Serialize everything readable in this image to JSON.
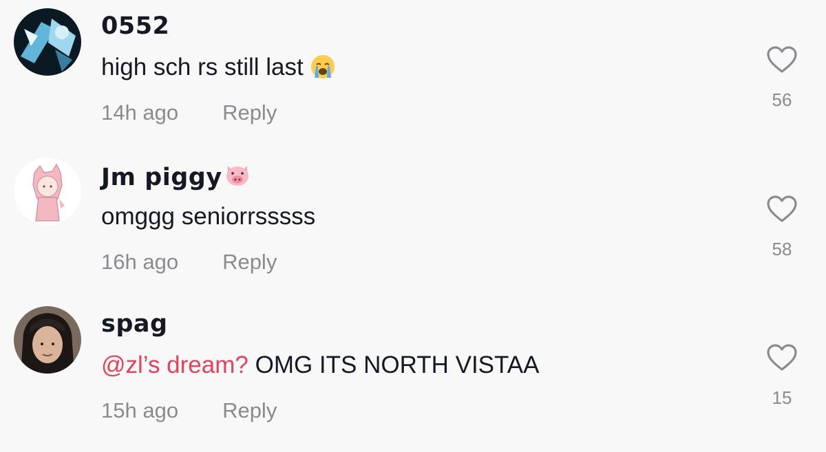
{
  "comments": [
    {
      "username": "0552",
      "username_emoji": "",
      "mention": "",
      "text": "high sch rs still last",
      "text_emoji": "loudly-crying-face-emoji",
      "time": "14h ago",
      "reply_label": "Reply",
      "likes": "56"
    },
    {
      "username": "Jm piggy",
      "username_emoji": "pig-face-emoji",
      "mention": "",
      "text": "omggg seniorrsssss",
      "text_emoji": "",
      "time": "16h ago",
      "reply_label": "Reply",
      "likes": "58"
    },
    {
      "username": "spag",
      "username_emoji": "",
      "mention": "@zl’s dream?",
      "text": "OMG ITS NORTH VISTAA",
      "text_emoji": "",
      "time": "15h ago",
      "reply_label": "Reply",
      "likes": "15"
    }
  ],
  "colors": {
    "background": "#f8f8f8",
    "text": "#161823",
    "secondary": "#8a8b91",
    "mention": "#e6435a"
  },
  "icons": [
    "heart-outline-icon"
  ]
}
